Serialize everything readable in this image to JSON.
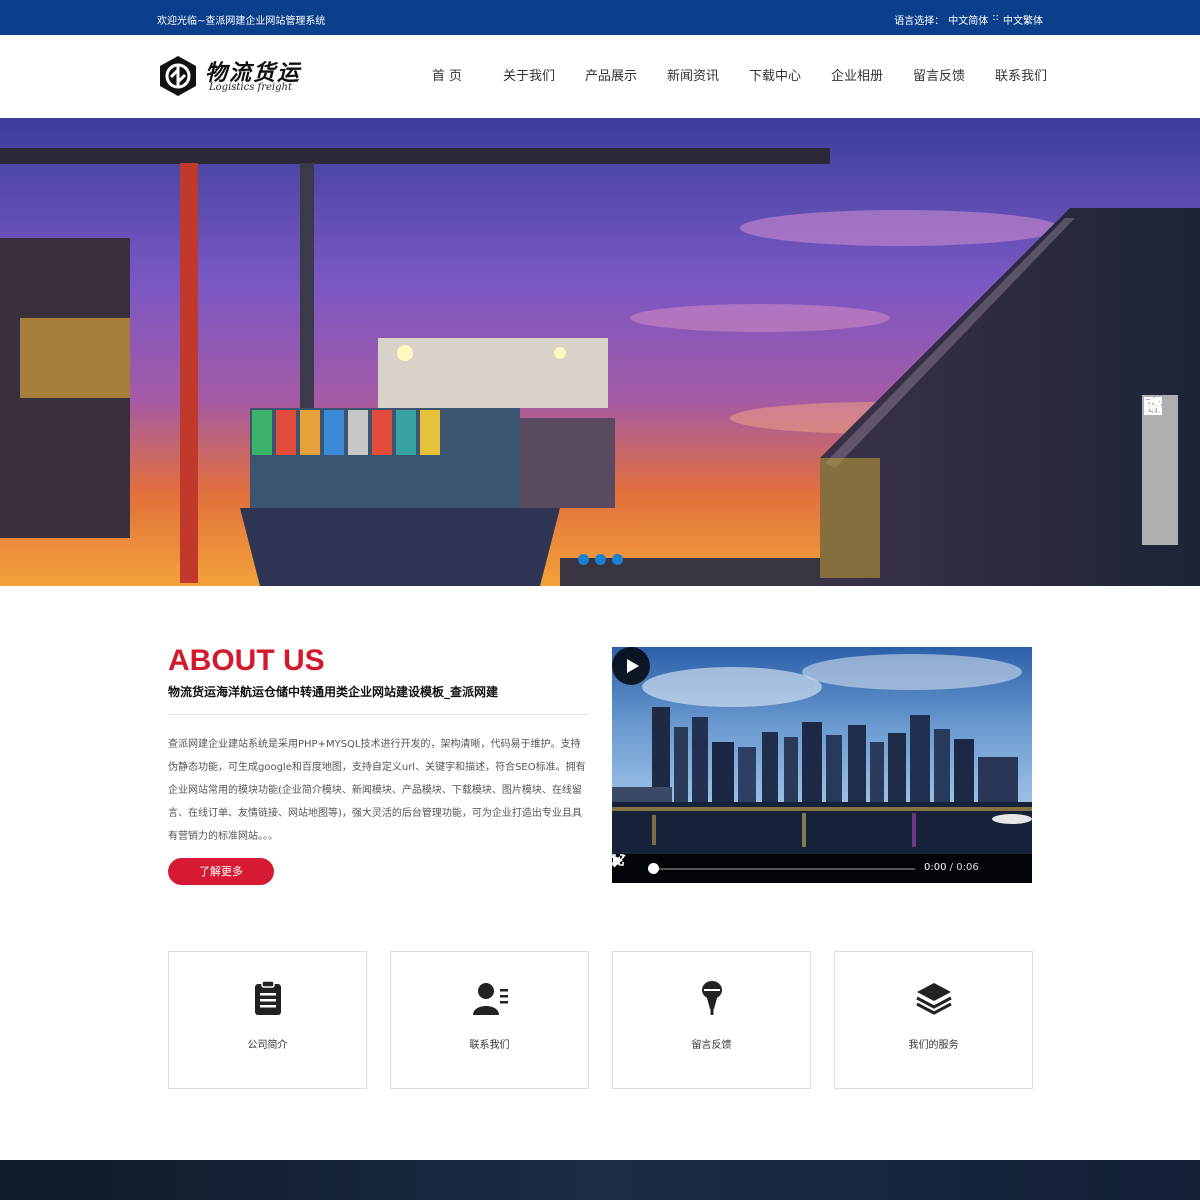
{
  "topbar": {
    "welcome": "欢迎光临~查派网建企业网站管理系统",
    "lang_label": "语言选择：",
    "lang_simplified": "中文简体",
    "lang_sep": "::",
    "lang_traditional": "中文繁体"
  },
  "header": {
    "logo_cn": "物流货运",
    "logo_en": "Logistics freight",
    "nav": [
      "首 页",
      "关于我们",
      "产品展示",
      "新闻资讯",
      "下载中心",
      "企业相册",
      "留言反馈",
      "联系我们"
    ]
  },
  "banner": {
    "slides_count": 3,
    "side_tools": [
      "headset-icon",
      "share-icon",
      "qrcode-icon",
      "rocket-icon"
    ]
  },
  "about": {
    "title": "ABOUT US",
    "subtitle": "物流货运海洋航运仓储中转通用类企业网站建设模板_查派网建",
    "text": "查派网建企业建站系统是采用PHP+MYSQL技术进行开发的，架构清晰，代码易于维护。支持伪静态功能，可生成google和百度地图，支持自定义url、关键字和描述，符合SEO标准。拥有企业网站常用的模块功能(企业简介模块、新闻模块、产品模块、下载模块、图片模块、在线留言、在线订单、友情链接、网站地图等)，强大灵活的后台管理功能，可为企业打造出专业且具有营销力的标准网站。。。",
    "button": "了解更多"
  },
  "video": {
    "current_time": "0:00",
    "separator": "/",
    "duration": "0:06"
  },
  "cards": [
    {
      "label": "公司简介",
      "icon": "clipboard-icon"
    },
    {
      "label": "联系我们",
      "icon": "contact-icon"
    },
    {
      "label": "留言反馈",
      "icon": "microphone-icon"
    },
    {
      "label": "我们的服务",
      "icon": "layers-icon"
    }
  ],
  "colors": {
    "topbar_bg": "#0b3f8c",
    "accent_red": "#d31a2c",
    "slider_dot": "#1a7fd6"
  }
}
